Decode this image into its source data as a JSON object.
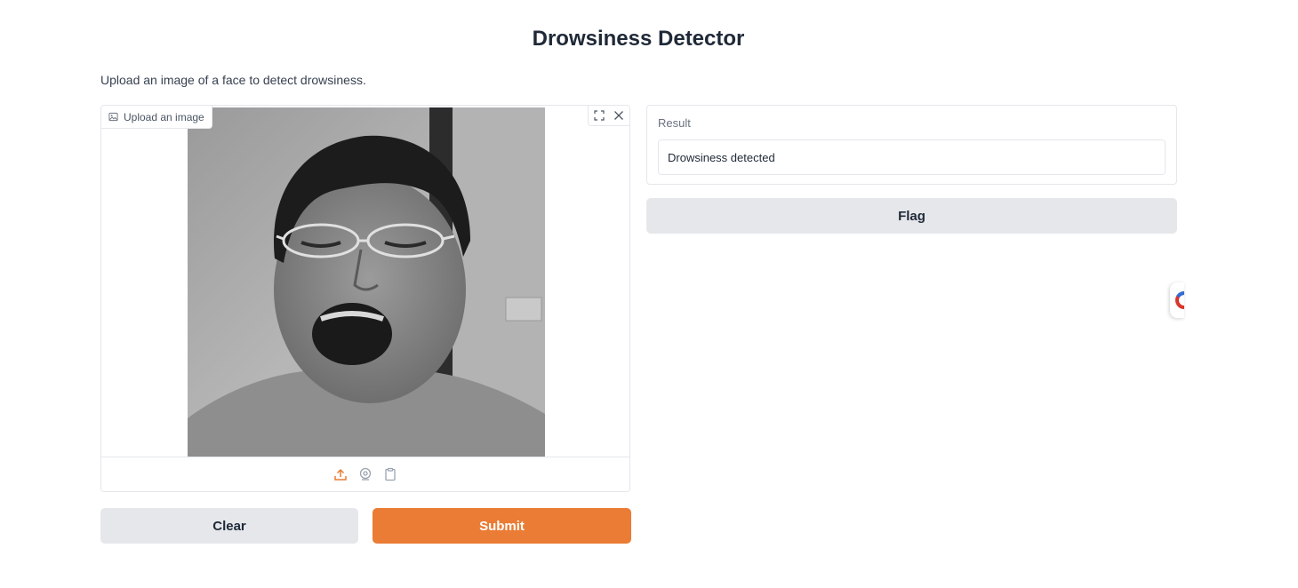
{
  "app": {
    "title": "Drowsiness Detector",
    "description": "Upload an image of a face to detect drowsiness."
  },
  "image_input": {
    "label": "Upload an image",
    "icons": {
      "label_icon": "image-icon",
      "fullscreen": "fullscreen-icon",
      "clear": "close-icon",
      "sources": [
        "upload-icon",
        "webcam-icon",
        "clipboard-icon"
      ]
    }
  },
  "buttons": {
    "clear": "Clear",
    "submit": "Submit",
    "flag": "Flag"
  },
  "output": {
    "label": "Result",
    "value": "Drowsiness detected"
  },
  "colors": {
    "accent": "#ea7c35",
    "secondary_button": "#e5e7eb",
    "border": "#e5e7eb"
  }
}
